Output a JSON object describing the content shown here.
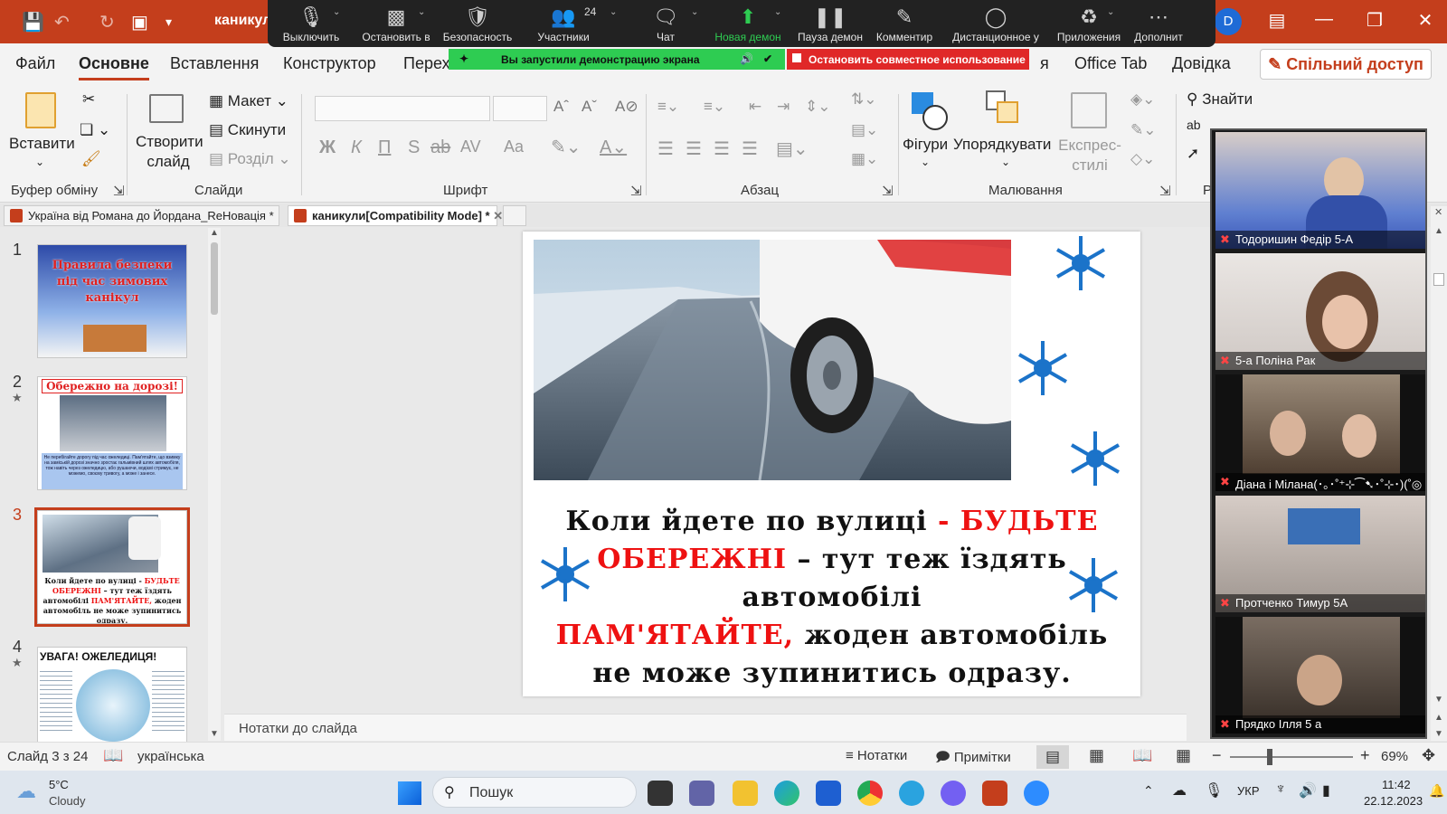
{
  "titlebar": {
    "doc_title": "каникул",
    "icons": [
      "save-icon",
      "undo-icon",
      "redo-icon",
      "present-icon",
      "customize-icon"
    ]
  },
  "zoom": {
    "items": [
      {
        "label": "Выключить",
        "icon": "microphone-icon"
      },
      {
        "label": "Остановить в",
        "icon": "video-camera-icon"
      },
      {
        "label": "Безопасность",
        "icon": "shield-icon"
      },
      {
        "label": "Участники",
        "icon": "participants-icon",
        "count": "24"
      },
      {
        "label": "Чат",
        "icon": "chat-icon"
      },
      {
        "label": "Новая демон",
        "icon": "share-screen-icon"
      },
      {
        "label": "Пауза демон",
        "icon": "pause-icon"
      },
      {
        "label": "Комментир",
        "icon": "pen-icon"
      },
      {
        "label": "Дистанционное у",
        "icon": "mouse-icon"
      },
      {
        "label": "Приложения",
        "icon": "apps-icon"
      },
      {
        "label": "Дополнит",
        "icon": "more-icon"
      }
    ],
    "sharing_banner": "Вы запустили демонстрацию экрана",
    "stop_sharing": "Остановить совместное использование"
  },
  "avatar": "D",
  "tabs": [
    "Файл",
    "Основне",
    "Вставлення",
    "Конструктор",
    "Перех",
    "я",
    "Office Tab",
    "Довідка"
  ],
  "share_button": "Спільний доступ",
  "ribbon": {
    "clipboard": {
      "paste": "Вставити",
      "label": "Буфер обміну"
    },
    "slides": {
      "new_slide": "Створити слайд",
      "layout": "Макет",
      "reset": "Скинути",
      "section": "Розділ",
      "label": "Слайди"
    },
    "font": {
      "label": "Шрифт",
      "bold": "Ж",
      "italic": "К",
      "underline": "П",
      "shadow": "S",
      "strike": "ab",
      "spacing": "AV",
      "case": "Aa"
    },
    "paragraph": {
      "label": "Абзац"
    },
    "drawing": {
      "shapes": "Фігури",
      "arrange": "Упорядкувати",
      "quick_styles": "Експрес-стилі",
      "label": "Малювання"
    },
    "editing": {
      "find": "Знайти",
      "replace": "Замінити",
      "label": "Р"
    }
  },
  "doc_tabs": [
    {
      "label": "Україна від Романа до Йордана_ReНовація *"
    },
    {
      "label": "каникули[Compatibility Mode] *"
    }
  ],
  "thumbnails": [
    {
      "num": "1",
      "text": "Правила безпеки під час зимових канікул"
    },
    {
      "num": "2",
      "text": "Обережно на дорозі!",
      "body": "Не перебігайте дорогу під час ожеледиці. Пам'ятайте, що взимку на заміській дорозі значно зростає гальмівний шлях автомобіля, тож навіть через ожеледицю, або рушаючи, водієві стримує, не можемо, своєму тривогу, а може і занесе."
    },
    {
      "num": "3",
      "text_a": "Коли йдете по вулиці -",
      "text_b": "БУДЬТЕ ОБЕРЕЖНІ",
      "text_c": "– тут теж їздять автомобілі",
      "text_d": "ПАМ'ЯТАЙТЕ,",
      "text_e": "жоден автомобіль не може зупинитись одразу."
    },
    {
      "num": "4",
      "text": "УВАГА! ОЖЕЛЕДИЦЯ!"
    }
  ],
  "slide": {
    "line1_a": "Коли йдете по вулиці",
    "line1_b": " -  БУДЬТЕ",
    "line2_a": "ОБЕРЕЖНІ",
    "line2_b": " – тут  теж їздять",
    "line3": "автомобілі",
    "line4_a": "ПАМ'ЯТАЙТЕ,",
    "line4_b": " жоден автомобіль",
    "line5": "не може зупинитись одразу."
  },
  "notes_placeholder": "Нотатки до слайда",
  "status": {
    "slide_count": "Слайд 3 з 24",
    "language": "українська",
    "notes": "Нотатки",
    "comments": "Примітки",
    "zoom": "69%"
  },
  "participants": [
    {
      "name": "Тодоришин Федір 5-А"
    },
    {
      "name": "5-а Поліна Рак"
    },
    {
      "name": "Діана і Мілана(･｡･˚⁺⊹⁀➷･˚⊹･)(˚◎"
    },
    {
      "name": "Протченко Тимур 5А"
    },
    {
      "name": "Прядко Ілля 5 а"
    }
  ],
  "taskbar": {
    "temp": "5°C",
    "weather": "Cloudy",
    "search": "Пошук",
    "lang": "УКР",
    "time": "11:42",
    "date": "22.12.2023"
  },
  "colors": {
    "accent": "#c43e1c",
    "zoom_green": "#2ecc52",
    "stop_red": "#e02828",
    "slide_red": "#ee1111",
    "snowflake": "#1b73c9"
  }
}
